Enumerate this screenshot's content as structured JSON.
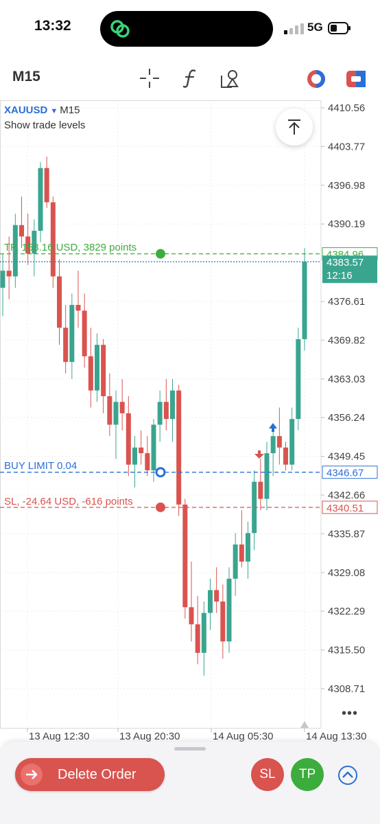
{
  "status_bar": {
    "time": "13:32",
    "network": "5G"
  },
  "toolbar": {
    "timeframe": "M15"
  },
  "chart": {
    "symbol": "XAUUSD",
    "timeframe": "M15",
    "show_trade_levels": "Show trade levels",
    "current_price": "4383.57",
    "countdown": "12:16",
    "more": "•••",
    "colors": {
      "bull": "#3aa58f",
      "bear": "#d9534f",
      "tp": "#3cad3c",
      "sl": "#d9534f",
      "buy": "#2b6fd6"
    },
    "levels": {
      "tp": {
        "label": "TP, 153.16 USD, 3829 points",
        "price": "4384.96"
      },
      "buy": {
        "label": "BUY LIMIT 0.04",
        "price": "4346.67"
      },
      "sl": {
        "label": "SL, -24.64 USD, -616 points",
        "price": "4340.51"
      }
    },
    "price_ticks": [
      "4410.56",
      "4403.77",
      "4396.98",
      "4390.19",
      "4376.61",
      "4369.82",
      "4363.03",
      "4356.24",
      "4349.45",
      "4342.66",
      "4335.87",
      "4329.08",
      "4322.29",
      "4315.50",
      "4308.71"
    ],
    "time_ticks": [
      "13 Aug 12:30",
      "13 Aug 20:30",
      "14 Aug 05:30",
      "14 Aug 13:30"
    ]
  },
  "chart_data": {
    "type": "candlestick",
    "symbol": "XAUUSD",
    "timeframe": "M15",
    "ylim": [
      4305,
      4412
    ],
    "candles": [
      [
        4379,
        4385,
        4374,
        4382
      ],
      [
        4382,
        4388,
        4377,
        4381
      ],
      [
        4381,
        4392,
        4379,
        4390
      ],
      [
        4390,
        4395,
        4386,
        4388
      ],
      [
        4388,
        4392,
        4383,
        4385
      ],
      [
        4385,
        4391,
        4381,
        4389
      ],
      [
        4389,
        4401,
        4387,
        4400
      ],
      [
        4400,
        4402,
        4393,
        4394
      ],
      [
        4394,
        4395,
        4379,
        4381
      ],
      [
        4381,
        4384,
        4369,
        4372
      ],
      [
        4372,
        4376,
        4364,
        4366
      ],
      [
        4366,
        4378,
        4363,
        4376
      ],
      [
        4376,
        4382,
        4372,
        4375
      ],
      [
        4375,
        4378,
        4365,
        4367
      ],
      [
        4367,
        4372,
        4358,
        4361
      ],
      [
        4361,
        4371,
        4359,
        4369
      ],
      [
        4369,
        4370,
        4357,
        4360
      ],
      [
        4360,
        4364,
        4353,
        4355
      ],
      [
        4355,
        4361,
        4349,
        4359
      ],
      [
        4359,
        4363,
        4354,
        4357
      ],
      [
        4357,
        4360,
        4346,
        4348
      ],
      [
        4348,
        4353,
        4344,
        4351
      ],
      [
        4351,
        4354,
        4348,
        4350
      ],
      [
        4350,
        4353,
        4346,
        4347
      ],
      [
        4347,
        4356,
        4345,
        4355
      ],
      [
        4355,
        4361,
        4352,
        4359
      ],
      [
        4359,
        4363,
        4354,
        4356
      ],
      [
        4356,
        4363,
        4352,
        4361
      ],
      [
        4361,
        4362,
        4339,
        4341
      ],
      [
        4341,
        4342,
        4321,
        4323
      ],
      [
        4323,
        4331,
        4317,
        4320
      ],
      [
        4320,
        4325,
        4313,
        4315
      ],
      [
        4315,
        4324,
        4311,
        4322
      ],
      [
        4322,
        4328,
        4319,
        4326
      ],
      [
        4326,
        4330,
        4322,
        4324
      ],
      [
        4324,
        4327,
        4314,
        4317
      ],
      [
        4317,
        4330,
        4315,
        4328
      ],
      [
        4328,
        4336,
        4325,
        4334
      ],
      [
        4334,
        4340,
        4330,
        4331
      ],
      [
        4331,
        4338,
        4328,
        4336
      ],
      [
        4336,
        4347,
        4333,
        4345
      ],
      [
        4345,
        4349,
        4340,
        4342
      ],
      [
        4342,
        4352,
        4340,
        4350
      ],
      [
        4350,
        4354,
        4346,
        4353
      ],
      [
        4353,
        4358,
        4348,
        4351
      ],
      [
        4351,
        4352,
        4347,
        4348
      ],
      [
        4348,
        4358,
        4347,
        4356
      ],
      [
        4356,
        4372,
        4354,
        4370
      ],
      [
        4370,
        4386,
        4368,
        4383.57
      ]
    ],
    "levels": {
      "tp": 4384.96,
      "buy_limit": 4346.67,
      "sl": 4340.51,
      "current": 4383.57
    }
  }
}
